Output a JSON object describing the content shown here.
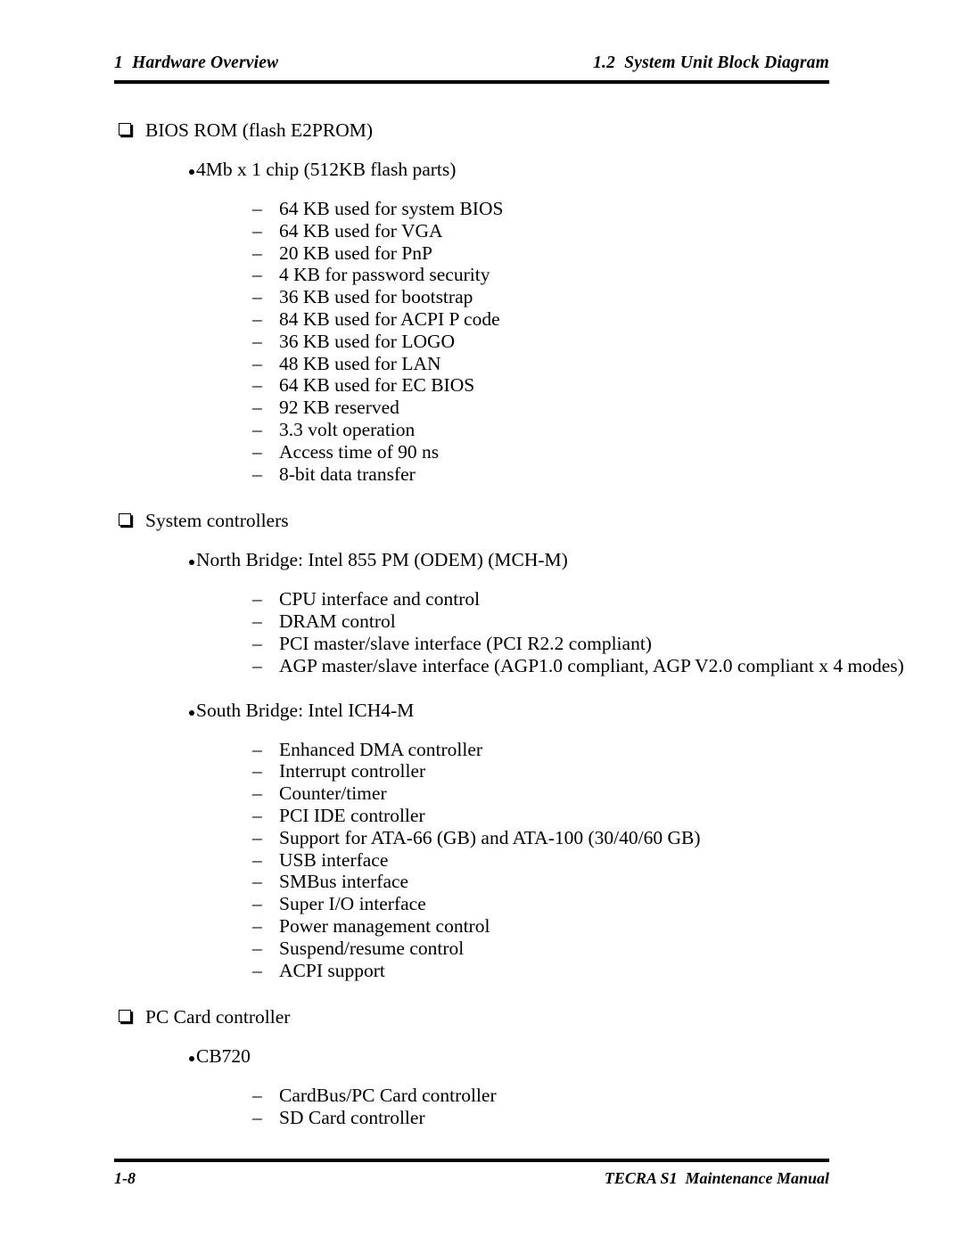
{
  "header": {
    "left": "1  Hardware Overview",
    "right": "1.2  System Unit Block Diagram"
  },
  "footer": {
    "page_number": "1-8",
    "manual_title": "TECRA S1  Maintenance Manual"
  },
  "sections": [
    {
      "heading": "BIOS ROM (flash E2PROM)",
      "groups": [
        {
          "label": "4Mb x 1 chip (512KB flash parts)",
          "items": [
            "64 KB used for system BIOS",
            "64 KB used for VGA",
            "20 KB used for PnP",
            "4 KB for password security",
            "36 KB used for bootstrap",
            "84 KB used for ACPI P code",
            "36 KB used for LOGO",
            "48 KB used for LAN",
            "64 KB used for EC BIOS",
            "92 KB reserved",
            "3.3 volt operation",
            "Access time of 90 ns",
            "8-bit data transfer"
          ]
        }
      ]
    },
    {
      "heading": "System controllers",
      "groups": [
        {
          "label": "North Bridge: Intel 855 PM (ODEM) (MCH-M)",
          "items": [
            "CPU interface and control",
            "DRAM control",
            "PCI master/slave interface (PCI R2.2 compliant)",
            "AGP master/slave interface (AGP1.0 compliant, AGP V2.0 compliant x 4 modes)"
          ]
        },
        {
          "label": "South Bridge: Intel ICH4-M",
          "items": [
            "Enhanced DMA controller",
            "Interrupt controller",
            "Counter/timer",
            "PCI IDE controller",
            "Support for ATA-66 (GB) and ATA-100 (30/40/60 GB)",
            "USB interface",
            "SMBus interface",
            "Super I/O interface",
            "Power management control",
            "Suspend/resume control",
            "ACPI support"
          ]
        }
      ]
    },
    {
      "heading": "PC Card controller",
      "groups": [
        {
          "label": "CB720",
          "items": [
            "CardBus/PC Card controller",
            "SD Card controller"
          ]
        }
      ]
    }
  ],
  "glyphs": {
    "dash": "–"
  }
}
